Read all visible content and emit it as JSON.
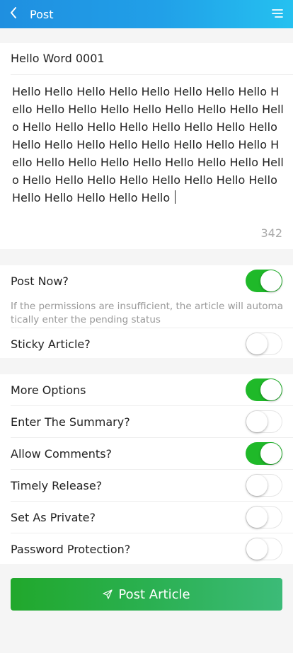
{
  "header": {
    "title": "Post",
    "back_icon": "chevron-left-icon",
    "menu_icon": "menu-icon",
    "gradient": [
      "#1f8fe0",
      "#25c1f0"
    ]
  },
  "editor": {
    "title_value": "Hello Word 0001",
    "content_value": "Hello Hello Hello Hello Hello Hello Hello Hello  Hello Hello Hello Hello Hello Hello Hello Hello Hello Hello Hello Hello Hello Hello Hello Hello Hello Hello Hello Hello Hello Hello Hello Hello Hello Hello Hello Hello Hello Hello Hello Hello Hello Hello Hello Hello Hello Hello  Hello Hello Hello Hello Hello Hello Hello Hello Hello ",
    "char_count": "342"
  },
  "publish": {
    "post_now_label": "Post Now?",
    "post_now_on": true,
    "hint": "If the permissions are insufficient, the article will automatically enter the pending status",
    "sticky_label": "Sticky Article?",
    "sticky_on": false
  },
  "options": {
    "more_label": "More Options",
    "more_on": true,
    "summary_label": "Enter The Summary?",
    "summary_on": false,
    "comments_label": "Allow Comments?",
    "comments_on": true,
    "timely_label": "Timely Release?",
    "timely_on": false,
    "private_label": "Set As Private?",
    "private_on": false,
    "password_label": "Password Protection?",
    "password_on": false
  },
  "submit": {
    "label": "Post Article",
    "icon": "send-icon"
  },
  "colors": {
    "switch_on": "#1fb929",
    "accent_button": "#2ab050"
  }
}
